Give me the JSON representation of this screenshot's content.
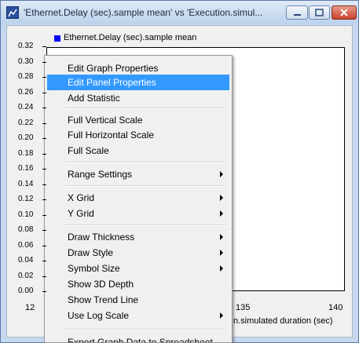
{
  "window": {
    "title": "'Ethernet.Delay (sec).sample mean' vs 'Execution.simul...",
    "icons": {
      "app": "graph-app-icon",
      "minimize": "minimize-icon",
      "maximize": "maximize-icon",
      "close": "close-icon"
    }
  },
  "chart_data": {
    "type": "line",
    "series": [
      {
        "name": "Ethernet.Delay (sec).sample mean",
        "color": "#0000ff"
      }
    ],
    "legend": "top-left",
    "y_ticks": [
      "0.32",
      "0.30",
      "0.28",
      "0.26",
      "0.24",
      "0.22",
      "0.20",
      "0.18",
      "0.16",
      "0.14",
      "0.12",
      "0.10",
      "0.08",
      "0.06",
      "0.04",
      "0.02",
      "0.00"
    ],
    "x_ticks": [
      "12",
      "135",
      "140"
    ],
    "xlabel": "n.simulated duration (sec)",
    "ylim": [
      0,
      0.32
    ],
    "grid": false
  },
  "menu": {
    "items": [
      {
        "label": "Edit Graph Properties",
        "highlighted": false,
        "submenu": false
      },
      {
        "label": "Edit Panel Properties",
        "highlighted": true,
        "submenu": false
      },
      {
        "label": "Add Statistic",
        "highlighted": false,
        "submenu": false
      },
      {
        "label": "Full Vertical Scale",
        "highlighted": false,
        "submenu": false
      },
      {
        "label": "Full Horizontal Scale",
        "highlighted": false,
        "submenu": false
      },
      {
        "label": "Full Scale",
        "highlighted": false,
        "submenu": false
      },
      {
        "label": "Range Settings",
        "highlighted": false,
        "submenu": true
      },
      {
        "label": "X Grid",
        "highlighted": false,
        "submenu": true
      },
      {
        "label": "Y Grid",
        "highlighted": false,
        "submenu": true
      },
      {
        "label": "Draw Thickness",
        "highlighted": false,
        "submenu": true
      },
      {
        "label": "Draw Style",
        "highlighted": false,
        "submenu": true
      },
      {
        "label": "Symbol Size",
        "highlighted": false,
        "submenu": true
      },
      {
        "label": "Show 3D Depth",
        "highlighted": false,
        "submenu": false
      },
      {
        "label": "Show Trend Line",
        "highlighted": false,
        "submenu": false
      },
      {
        "label": "Use Log Scale",
        "highlighted": false,
        "submenu": true
      },
      {
        "label": "Export Graph Data to Spreadsheet",
        "highlighted": false,
        "submenu": false
      }
    ],
    "colors": {
      "highlight": "#3399ff"
    }
  }
}
